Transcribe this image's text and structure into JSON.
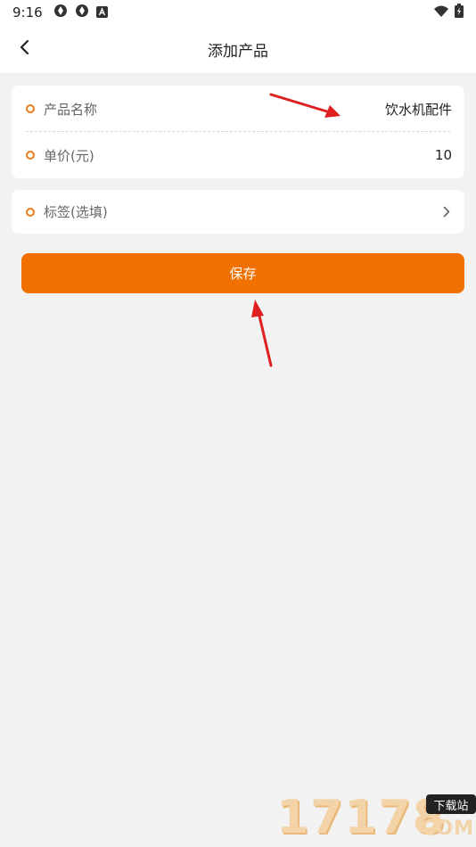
{
  "status_bar": {
    "time": "9:16"
  },
  "header": {
    "title": "添加产品"
  },
  "form": {
    "product_name": {
      "label": "产品名称",
      "value": "饮水机配件"
    },
    "unit_price": {
      "label": "单价(元)",
      "value": "10"
    },
    "tags": {
      "label": "标签(选填)"
    }
  },
  "actions": {
    "save_label": "保存"
  },
  "watermark": {
    "digits": "17178",
    "badge": "下载站",
    "suffix": "COM"
  },
  "colors": {
    "accent": "#f07000",
    "background": "#f2f2f2",
    "card": "#ffffff",
    "annotation": "#e02020"
  }
}
